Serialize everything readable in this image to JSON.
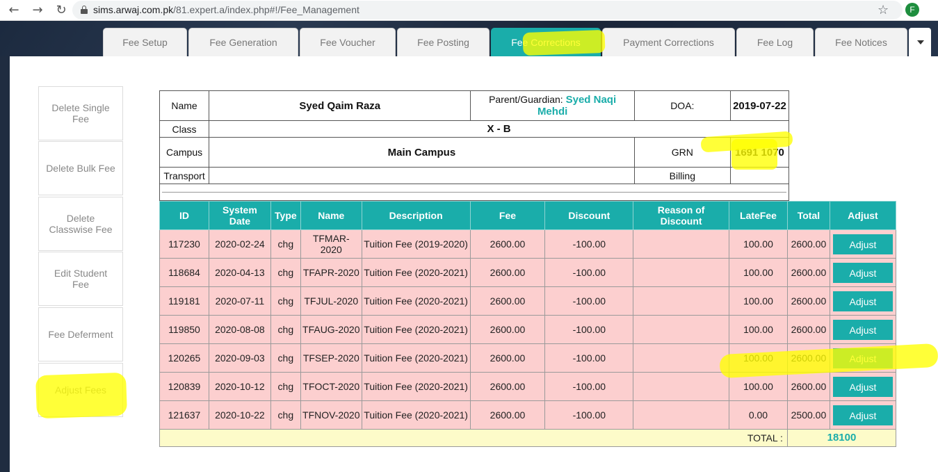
{
  "browser": {
    "url_host": "sims.arwaj.com.pk",
    "url_path": "/81.expert.a/index.php#!/Fee_Management",
    "profile_initial": "F"
  },
  "tabs": [
    {
      "label": "Fee Setup",
      "active": false
    },
    {
      "label": "Fee Generation",
      "active": false
    },
    {
      "label": "Fee Voucher",
      "active": false
    },
    {
      "label": "Fee Posting",
      "active": false
    },
    {
      "label": "Fee Corrections",
      "active": true
    },
    {
      "label": "Payment Corrections",
      "active": false
    },
    {
      "label": "Fee Log",
      "active": false
    },
    {
      "label": "Fee Notices",
      "active": false
    }
  ],
  "sidebar": {
    "items": [
      {
        "label": "Delete Single Fee"
      },
      {
        "label": "Delete Bulk Fee"
      },
      {
        "label": "Delete Classwise Fee"
      },
      {
        "label": "Edit Student Fee"
      },
      {
        "label": "Fee Deferment"
      },
      {
        "label": "Adjust Fees"
      }
    ]
  },
  "student": {
    "name_label": "Name",
    "name": "Syed Qaim Raza",
    "guardian_label": "Parent/Guardian:",
    "guardian": "Syed Naqi Mehdi",
    "doa_label": "DOA:",
    "doa": "2019-07-22",
    "class_label": "Class",
    "class": "X - B",
    "campus_label": "Campus",
    "campus": "Main Campus",
    "grn_label": "GRN",
    "grn": "1691 1070",
    "transport_label": "Transport",
    "transport": "",
    "billing_label": "Billing",
    "billing": ""
  },
  "fee_table": {
    "headers": [
      "ID",
      "System Date",
      "Type",
      "Name",
      "Description",
      "Fee",
      "Discount",
      "Reason of Discount",
      "LateFee",
      "Total",
      "Adjust"
    ],
    "rows": [
      {
        "id": "117230",
        "date": "2020-02-24",
        "type": "chg",
        "name": "TFMAR-2020",
        "description": "Tuition Fee (2019-2020)",
        "fee": "2600.00",
        "discount": "-100.00",
        "reason": "",
        "late_fee": "100.00",
        "total": "2600.00",
        "action": "Adjust"
      },
      {
        "id": "118684",
        "date": "2020-04-13",
        "type": "chg",
        "name": "TFAPR-2020",
        "description": "Tuition Fee (2020-2021)",
        "fee": "2600.00",
        "discount": "-100.00",
        "reason": "",
        "late_fee": "100.00",
        "total": "2600.00",
        "action": "Adjust"
      },
      {
        "id": "119181",
        "date": "2020-07-11",
        "type": "chg",
        "name": "TFJUL-2020",
        "description": "Tuition Fee (2020-2021)",
        "fee": "2600.00",
        "discount": "-100.00",
        "reason": "",
        "late_fee": "100.00",
        "total": "2600.00",
        "action": "Adjust"
      },
      {
        "id": "119850",
        "date": "2020-08-08",
        "type": "chg",
        "name": "TFAUG-2020",
        "description": "Tuition Fee (2020-2021)",
        "fee": "2600.00",
        "discount": "-100.00",
        "reason": "",
        "late_fee": "100.00",
        "total": "2600.00",
        "action": "Adjust"
      },
      {
        "id": "120265",
        "date": "2020-09-03",
        "type": "chg",
        "name": "TFSEP-2020",
        "description": "Tuition Fee (2020-2021)",
        "fee": "2600.00",
        "discount": "-100.00",
        "reason": "",
        "late_fee": "100.00",
        "total": "2600.00",
        "action": "Adjust"
      },
      {
        "id": "120839",
        "date": "2020-10-12",
        "type": "chg",
        "name": "TFOCT-2020",
        "description": "Tuition Fee (2020-2021)",
        "fee": "2600.00",
        "discount": "-100.00",
        "reason": "",
        "late_fee": "100.00",
        "total": "2600.00",
        "action": "Adjust"
      },
      {
        "id": "121637",
        "date": "2020-10-22",
        "type": "chg",
        "name": "TFNOV-2020",
        "description": "Tuition Fee (2020-2021)",
        "fee": "2600.00",
        "discount": "-100.00",
        "reason": "",
        "late_fee": "0.00",
        "total": "2500.00",
        "action": "Adjust"
      }
    ],
    "total_label": "TOTAL :",
    "total_value": "18100"
  },
  "colors": {
    "accent": "#1aadaa",
    "row_bg": "#fccfcf",
    "total_bg": "#fdfbc9",
    "highlight": "#ffff00"
  },
  "icons": [
    "back-arrow-icon",
    "forward-arrow-icon",
    "reload-icon",
    "lock-icon",
    "star-icon",
    "chevron-down-icon"
  ]
}
